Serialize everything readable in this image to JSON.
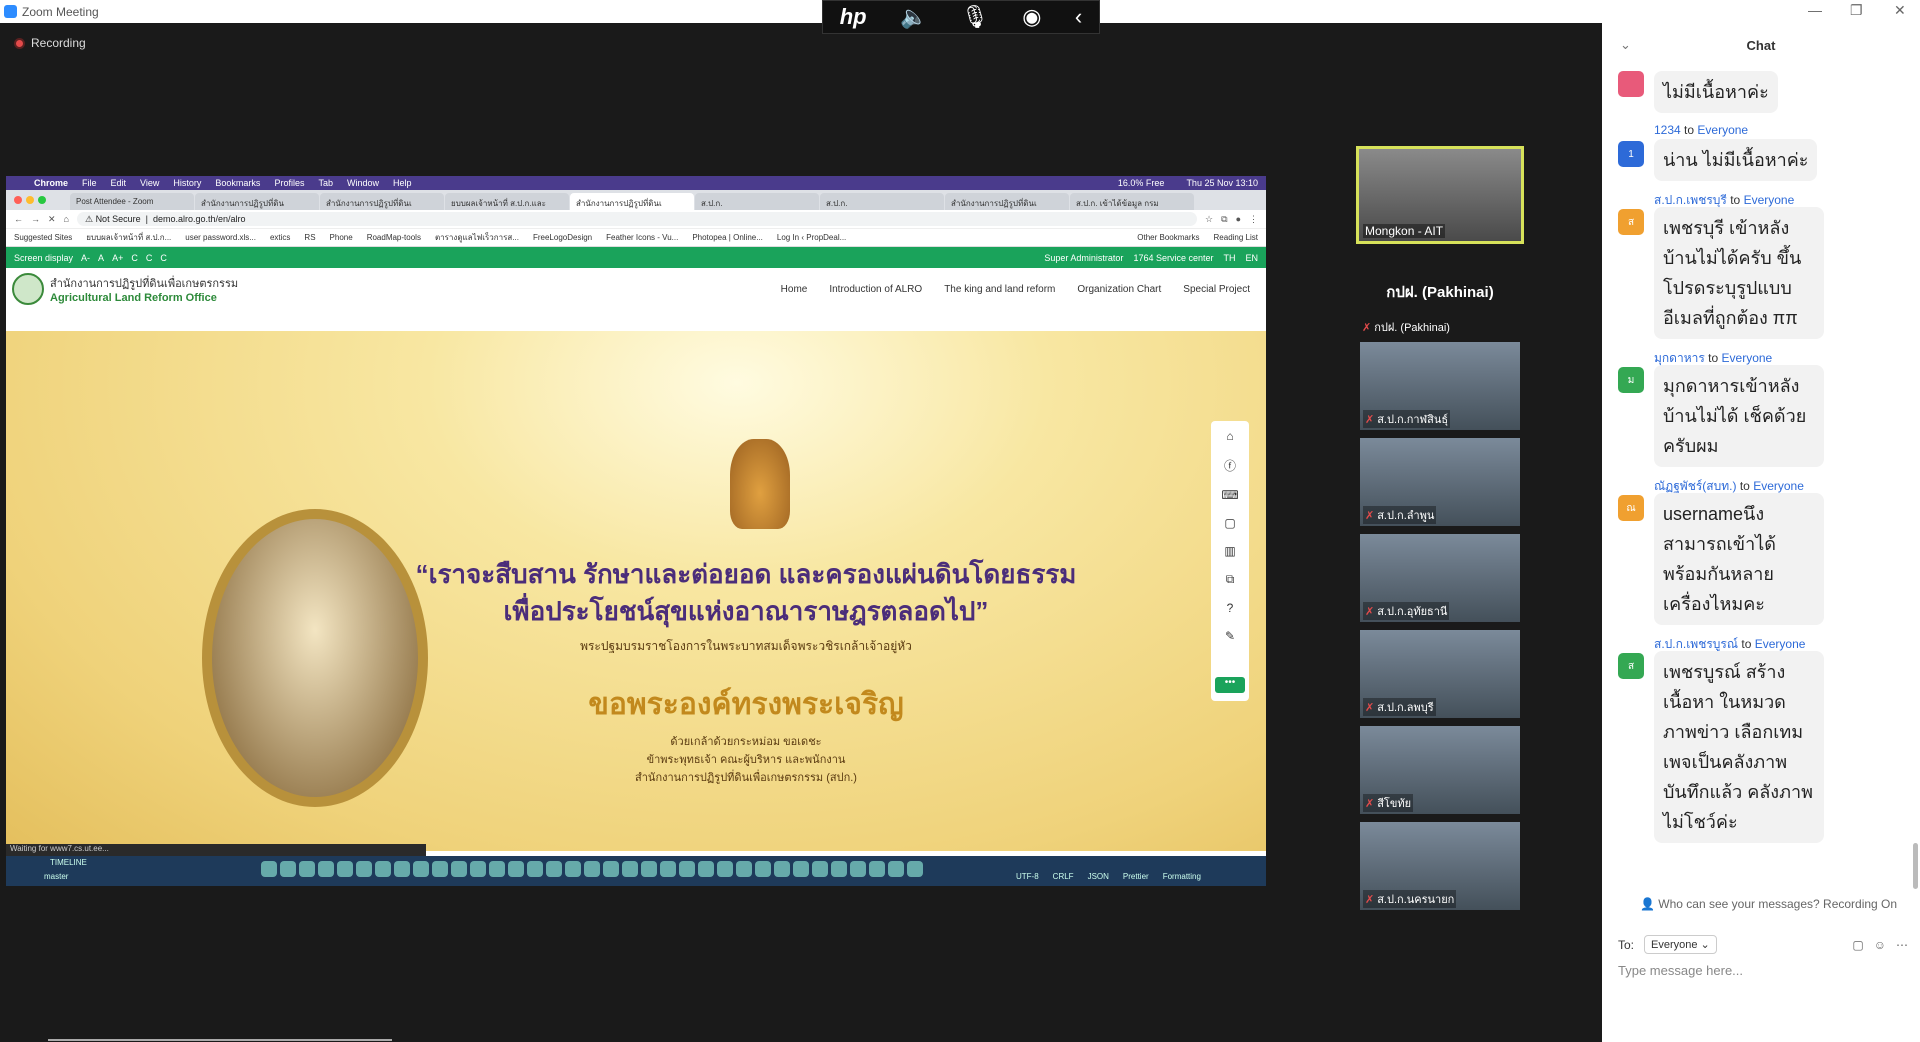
{
  "window": {
    "title": "Zoom Meeting"
  },
  "recording": {
    "label": "Recording"
  },
  "hp_toolbar": {
    "icons": [
      "hp-logo-icon",
      "speaker-icon",
      "microphone-icon",
      "broadcast-icon",
      "chevron-left-icon"
    ]
  },
  "mac_menu": {
    "items": [
      "Chrome",
      "File",
      "Edit",
      "View",
      "History",
      "Bookmarks",
      "Profiles",
      "Tab",
      "Window",
      "Help"
    ],
    "clock": "Thu 25 Nov 13:10",
    "battery": "16.0% Free"
  },
  "browser": {
    "tabs": [
      "Post Attendee - Zoom",
      "สำนักงานการปฏิรูปที่ดิน",
      "สำนักงานการปฏิรูปที่ดินเ",
      "ยบบผลเจ้าหน้าที่ ส.ป.ก.และ",
      "สำนักงานการปฏิรูปที่ดินเ",
      "ส.ป.ก.",
      "ส.ป.ก.",
      "สำนักงานการปฏิรูปที่ดินเ",
      "ส.ป.ก. เข้าได้ข้อมูล กรม"
    ],
    "security": "Not Secure",
    "url": "demo.alro.go.th/en/alro",
    "bookmarks": [
      "Suggested Sites",
      "ยบบผลเจ้าหน้าที่ ส.ป.ก...",
      "user password.xls...",
      "extics",
      "RS",
      "Phone",
      "RoadMap-tools",
      "ตารางดูแลไฟเร็วการส...",
      "FreeLogoDesign",
      "Feather Icons - Vu...",
      "Photopea | Online...",
      "Log In ‹ PropDeal...",
      "Other Bookmarks",
      "Reading List"
    ]
  },
  "site": {
    "screen_display": "Screen display",
    "font_sizes": [
      "A-",
      "A",
      "A+"
    ],
    "contrast": [
      "C",
      "C",
      "C"
    ],
    "admin": "Super Administrator",
    "service": "1764 Service center",
    "langs": [
      "TH",
      "EN"
    ],
    "org_th": "สำนักงานการปฏิรูปที่ดินเพื่อเกษตรกรรม",
    "org_en": "Agricultural Land Reform Office",
    "nav": [
      "Home",
      "Introduction of ALRO",
      "The king and land reform",
      "Organization Chart",
      "Special Project"
    ],
    "quote_line1": "“เราจะสืบสาน รักษาและต่อยอด และครองแผ่นดินโดยธรรม",
    "quote_line2": "เพื่อประโยชน์สุขแห่งอาณาราษฎรตลอดไป”",
    "quote_sub": "พระปฐมบรมราชโองการในพระบาทสมเด็จพระวชิรเกล้าเจ้าอยู่หัว",
    "blessing": "ขอพระองค์ทรงพระเจริญ",
    "blessing_l1": "ด้วยเกล้าด้วยกระหม่อม ขอเดชะ",
    "blessing_l2": "ข้าพระพุทธเจ้า คณะผู้บริหาร และพนักงาน",
    "blessing_l3": "สำนักงานการปฏิรูปที่ดินเพื่อเกษตรกรรม (สปก.)",
    "side_icons": [
      "home-icon",
      "facebook-icon",
      "keyboard-icon",
      "comment-icon",
      "chart-icon",
      "sitemap-icon",
      "help-icon",
      "edit-icon"
    ],
    "more": "•••",
    "status": "Waiting for www7.cs.ut.ee...",
    "timeline": "TIMELINE",
    "branch": "master",
    "vscode_status": [
      "UTF-8",
      "CRLF",
      "JSON",
      "Prettier",
      "Formatting"
    ]
  },
  "participants": {
    "speaker": "Mongkon - AIT",
    "featured_name": "กปฝ. (Pakhinai)",
    "featured_label": "กปฝ. (Pakhinai)",
    "thumbs": [
      "ส.ป.ก.กาฬสินธุ์",
      "ส.ป.ก.ลำพูน",
      "ส.ป.ก.อุทัยธานี",
      "ส.ป.ก.ลพบุรี",
      "สีโขทัย",
      "ส.ป.ก.นครนายก"
    ]
  },
  "chat": {
    "title": "Chat",
    "messages": [
      {
        "from": "",
        "to": "",
        "avatar": "",
        "color": "#e85a7a",
        "text": "ไม่มีเนื้อหาค่ะ"
      },
      {
        "from": "1234",
        "to": "Everyone",
        "avatar": "1",
        "color": "#2d6ad8",
        "text": "น่าน ไม่มีเนื้อหาค่ะ"
      },
      {
        "from": "ส.ป.ก.เพชรบุรี",
        "to": "Everyone",
        "avatar": "ส",
        "color": "#f0a030",
        "text": "เพชรบุรี เข้าหลังบ้านไม่ได้ครับ ขึ้นโปรดระบุรูปแบบอีเมลที่ถูกต้อง ππ"
      },
      {
        "from": "มุกดาหาร",
        "to": "Everyone",
        "avatar": "ม",
        "color": "#34a853",
        "text": "มุกดาหารเข้าหลังบ้านไม่ได้ เช็คด้วยครับผม"
      },
      {
        "from": "ณัฏฐพัชร์(สบท.)",
        "to": "Everyone",
        "avatar": "ณ",
        "color": "#f0a030",
        "text": "usernameนึง สามารถเข้าได้พร้อมกันหลายเครื่องไหมคะ"
      },
      {
        "from": "ส.ป.ก.เพชรบูรณ์",
        "to": "Everyone",
        "avatar": "ส",
        "color": "#34a853",
        "text": "เพชรบูรณ์ สร้างเนื้อหา ในหมวดภาพข่าว เลือกเทมเพจเป็นคลังภาพ บันทึกแล้ว คลังภาพไม่โชว์ค่ะ"
      }
    ],
    "to_word": "to",
    "privacy": "Who can see your messages? Recording On",
    "to_label": "To:",
    "recipient": "Everyone",
    "placeholder": "Type message here..."
  }
}
